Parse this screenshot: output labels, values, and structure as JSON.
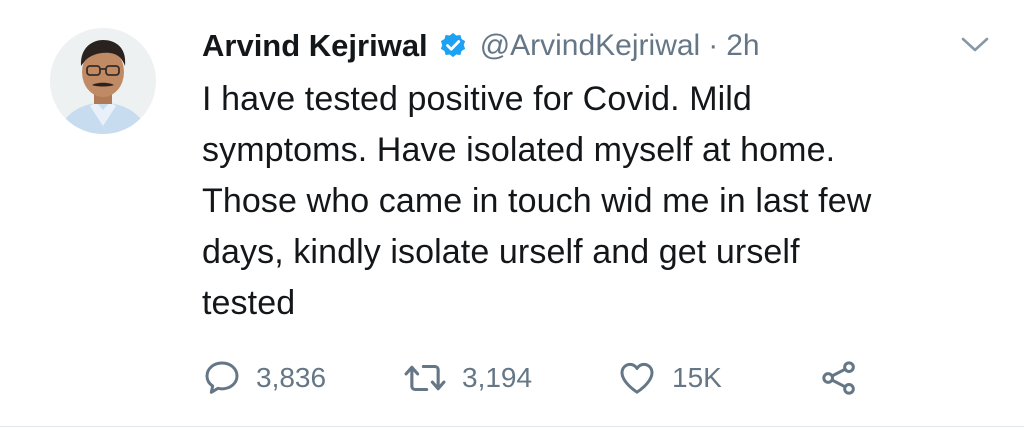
{
  "tweet": {
    "author_name": "Arvind Kejriwal",
    "handle": "@ArvindKejriwal",
    "separator": "·",
    "timestamp": "2h",
    "text_lines": [
      "I have tested positive for Covid. Mild",
      "symptoms. Have isolated myself at home.",
      "Those who came in touch wid me in last few",
      "days, kindly isolate urself and get urself",
      "tested"
    ],
    "actions": {
      "replies": "3,836",
      "retweets": "3,194",
      "likes": "15K"
    }
  },
  "colors": {
    "verified": "#1da1f2",
    "text": "#14171a",
    "secondary": "#657786",
    "divider": "#e1e8ed"
  },
  "icons": {
    "verified": "verified-badge-icon",
    "caret": "chevron-down-icon",
    "reply": "reply-bubble-icon",
    "retweet": "retweet-icon",
    "like": "heart-icon",
    "share": "share-icon"
  }
}
